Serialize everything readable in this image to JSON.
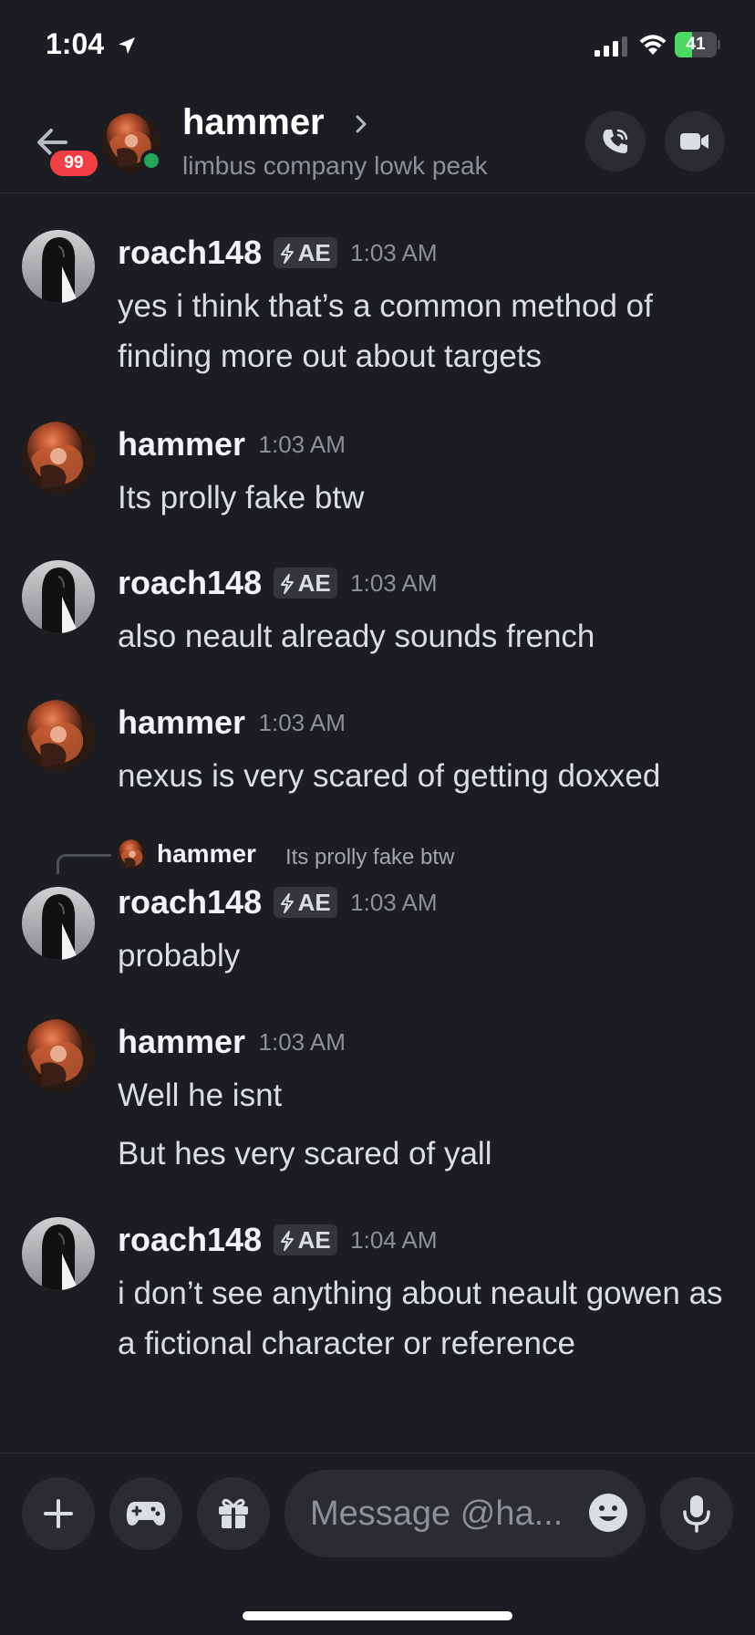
{
  "status_bar": {
    "time": "1:04",
    "battery_text": "41",
    "battery_level_percent": 41
  },
  "header": {
    "back_icon": "arrow-left-icon",
    "unread_badge": "99",
    "name": "hammer",
    "status": "limbus company lowk peak",
    "presence": "online",
    "call_icon": "phone-icon",
    "video_icon": "video-camera-icon"
  },
  "colors": {
    "background": "#1c1d22",
    "badge": "#f23f43",
    "online": "#23a55a",
    "battery": "#4cd964",
    "muted_text": "#8e9099"
  },
  "messages": [
    {
      "author": "roach148",
      "tag": "AE",
      "time": "1:03 AM",
      "lines": [
        "yes i think that’s a common method of finding more out about targets"
      ]
    },
    {
      "author": "hammer",
      "time": "1:03 AM",
      "lines": [
        "Its prolly fake btw"
      ]
    },
    {
      "author": "roach148",
      "tag": "AE",
      "time": "1:03 AM",
      "lines": [
        "also neault already sounds french"
      ]
    },
    {
      "author": "hammer",
      "time": "1:03 AM",
      "lines": [
        "nexus is very scared of getting doxxed"
      ]
    },
    {
      "author": "roach148",
      "tag": "AE",
      "time": "1:03 AM",
      "reply_to": {
        "author": "hammer",
        "text": "Its prolly fake btw"
      },
      "lines": [
        "probably"
      ]
    },
    {
      "author": "hammer",
      "time": "1:03 AM",
      "lines": [
        "Well he isnt",
        "But hes very scared of yall"
      ]
    },
    {
      "author": "roach148",
      "tag": "AE",
      "time": "1:04 AM",
      "lines": [
        "i don’t see anything about neault gowen as a fictional character or reference"
      ]
    }
  ],
  "composer": {
    "placeholder": "Message @ha...",
    "plus_icon": "plus-icon",
    "game_icon": "gamepad-icon",
    "gift_icon": "gift-icon",
    "emoji_icon": "emoji-icon",
    "mic_icon": "microphone-icon"
  }
}
